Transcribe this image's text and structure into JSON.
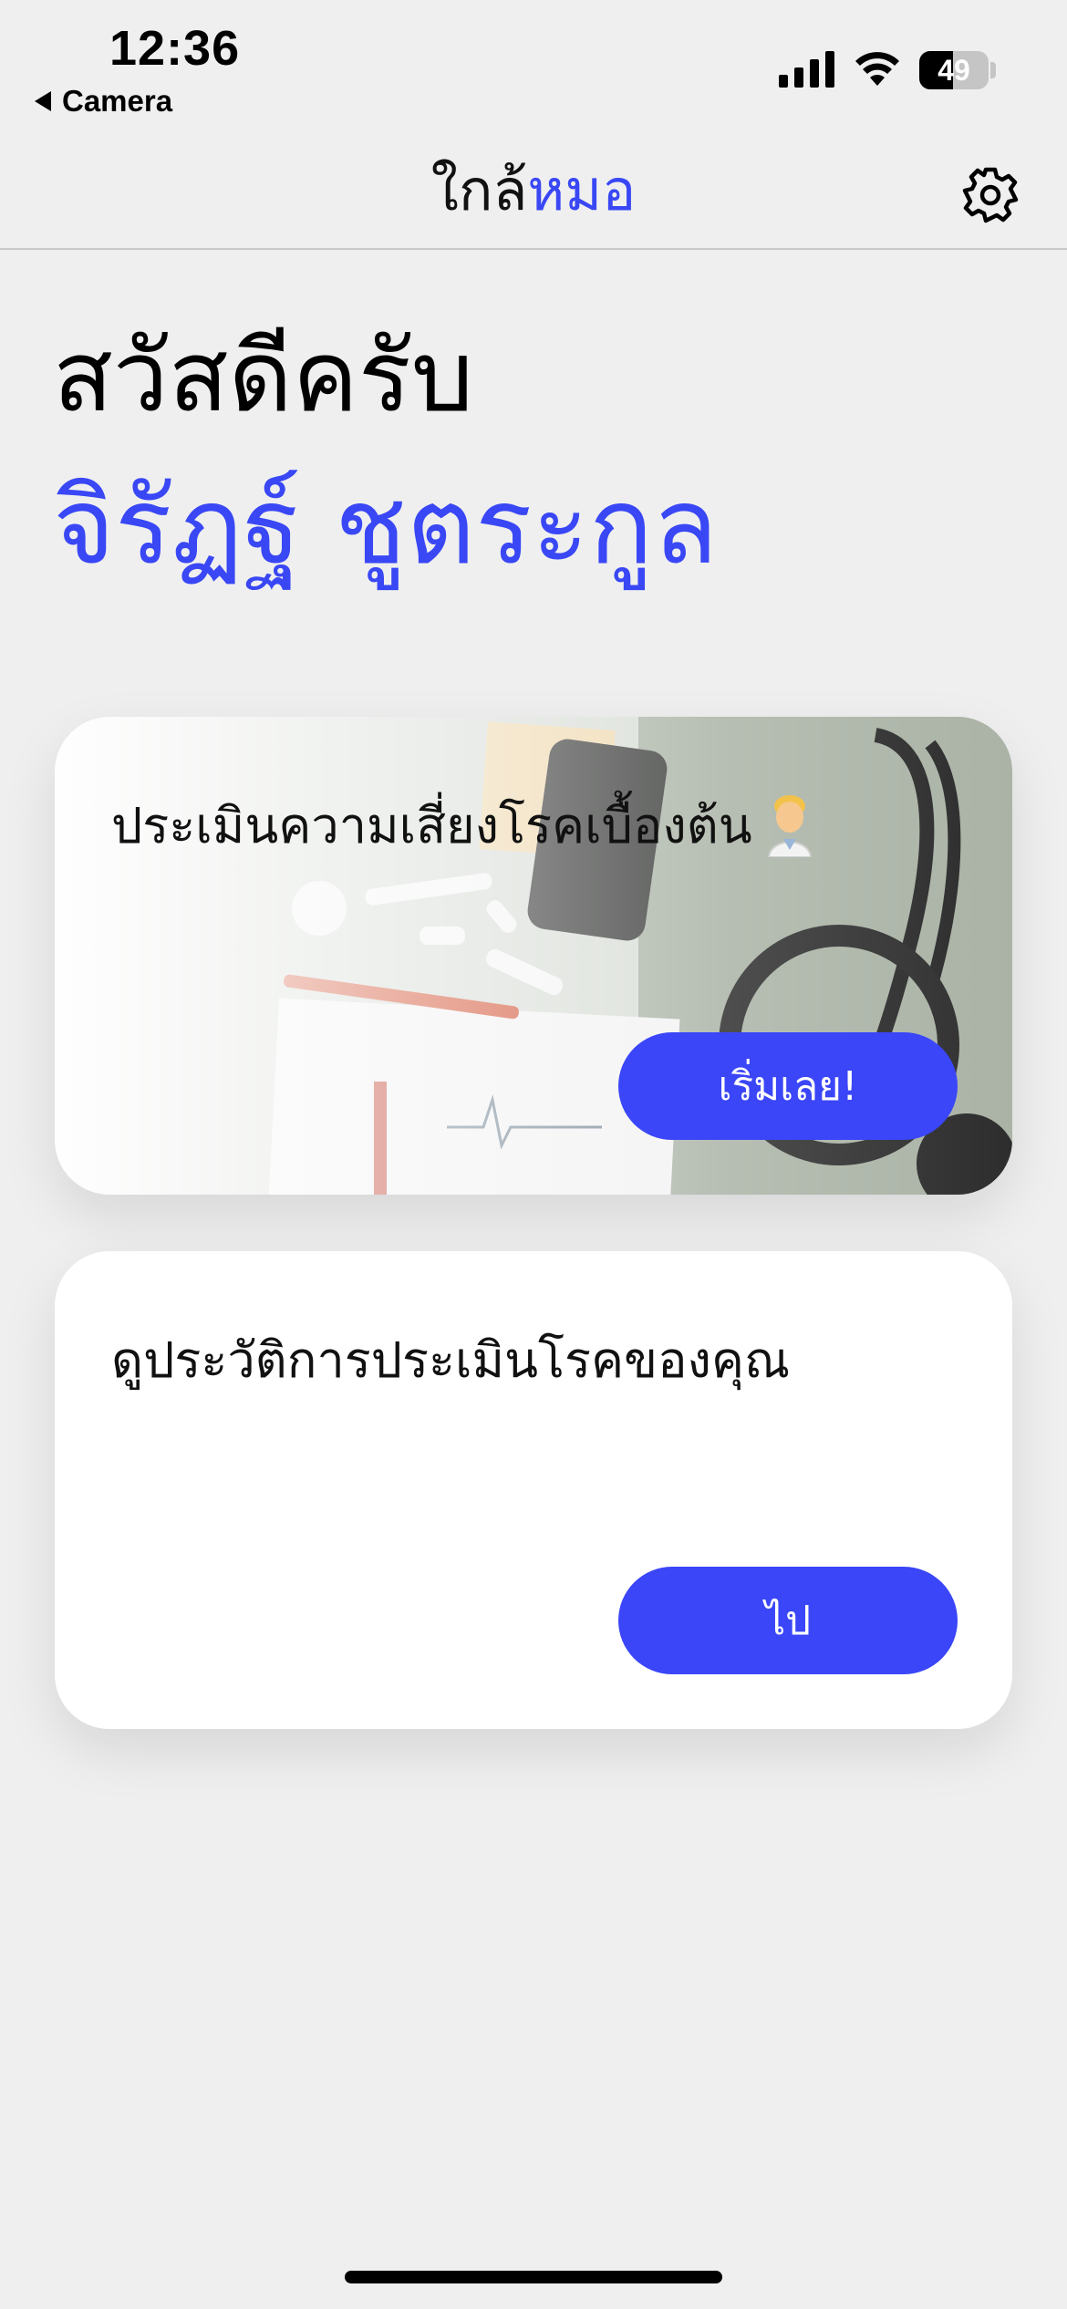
{
  "status_bar": {
    "time": "12:36",
    "back_app": "Camera",
    "battery_level": "49",
    "icons": [
      "signal-icon",
      "wifi-icon",
      "battery-icon"
    ]
  },
  "nav": {
    "title_part1": "ใกล้",
    "title_part2": "หมอ",
    "settings_icon": "gear-icon"
  },
  "greeting": {
    "hello": "สวัสดีครับ",
    "name": "จิรัฏฐ์ ชูตระกูล"
  },
  "cards": [
    {
      "title": "ประเมินความเสี่ยงโรคเบื้องต้น",
      "emoji_icon": "doctor-icon",
      "button": "เริ่มเลย!"
    },
    {
      "title": "ดูประวัติการประเมินโรคของคุณ",
      "button": "ไป"
    }
  ],
  "colors": {
    "accent": "#3947f5",
    "background": "#efefef",
    "card": "#ffffff",
    "button": "#3a46f7"
  }
}
